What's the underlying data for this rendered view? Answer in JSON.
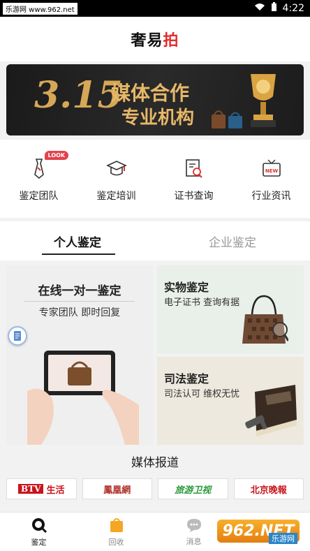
{
  "status_bar": {
    "watermark": "乐游网 www.962.net",
    "time": "4:22"
  },
  "header": {
    "title_main": "奢易",
    "title_accent": "拍"
  },
  "banner": {
    "number": "3.15",
    "line1": "媒体合作",
    "line2": "专业机构"
  },
  "quick_nav": [
    {
      "label": "鉴定团队",
      "icon": "tie-icon",
      "badge": "LOOK"
    },
    {
      "label": "鉴定培训",
      "icon": "graduation-cap-icon"
    },
    {
      "label": "证书查询",
      "icon": "certificate-search-icon"
    },
    {
      "label": "行业资讯",
      "icon": "news-tv-icon"
    }
  ],
  "tabs": [
    {
      "label": "个人鉴定",
      "active": true
    },
    {
      "label": "企业鉴定",
      "active": false
    }
  ],
  "cards": {
    "online": {
      "title": "在线一对一鉴定",
      "subtitle": "专家团队  即时回复"
    },
    "physical": {
      "title": "实物鉴定",
      "subtitle": "电子证书 查询有据"
    },
    "judicial": {
      "title": "司法鉴定",
      "subtitle": "司法认可 维权无忧"
    }
  },
  "media": {
    "title": "媒体报道",
    "logos": [
      {
        "box": "BTV",
        "text": "生活"
      },
      {
        "text": "鳳凰網"
      },
      {
        "text": "旅游卫视"
      },
      {
        "text": "北京晚報"
      }
    ]
  },
  "tabbar": [
    {
      "label": "鉴定",
      "icon": "search-icon",
      "active": true
    },
    {
      "label": "回收",
      "icon": "recycle-bag-icon",
      "active": false
    },
    {
      "label": "消息",
      "icon": "message-icon",
      "active": false
    }
  ],
  "watermark_br": {
    "text": "962.NET",
    "sub": "乐游网"
  },
  "colors": {
    "accent_red": "#e02e2e",
    "gold": "#e7b868",
    "badge_red": "#e4414c"
  }
}
